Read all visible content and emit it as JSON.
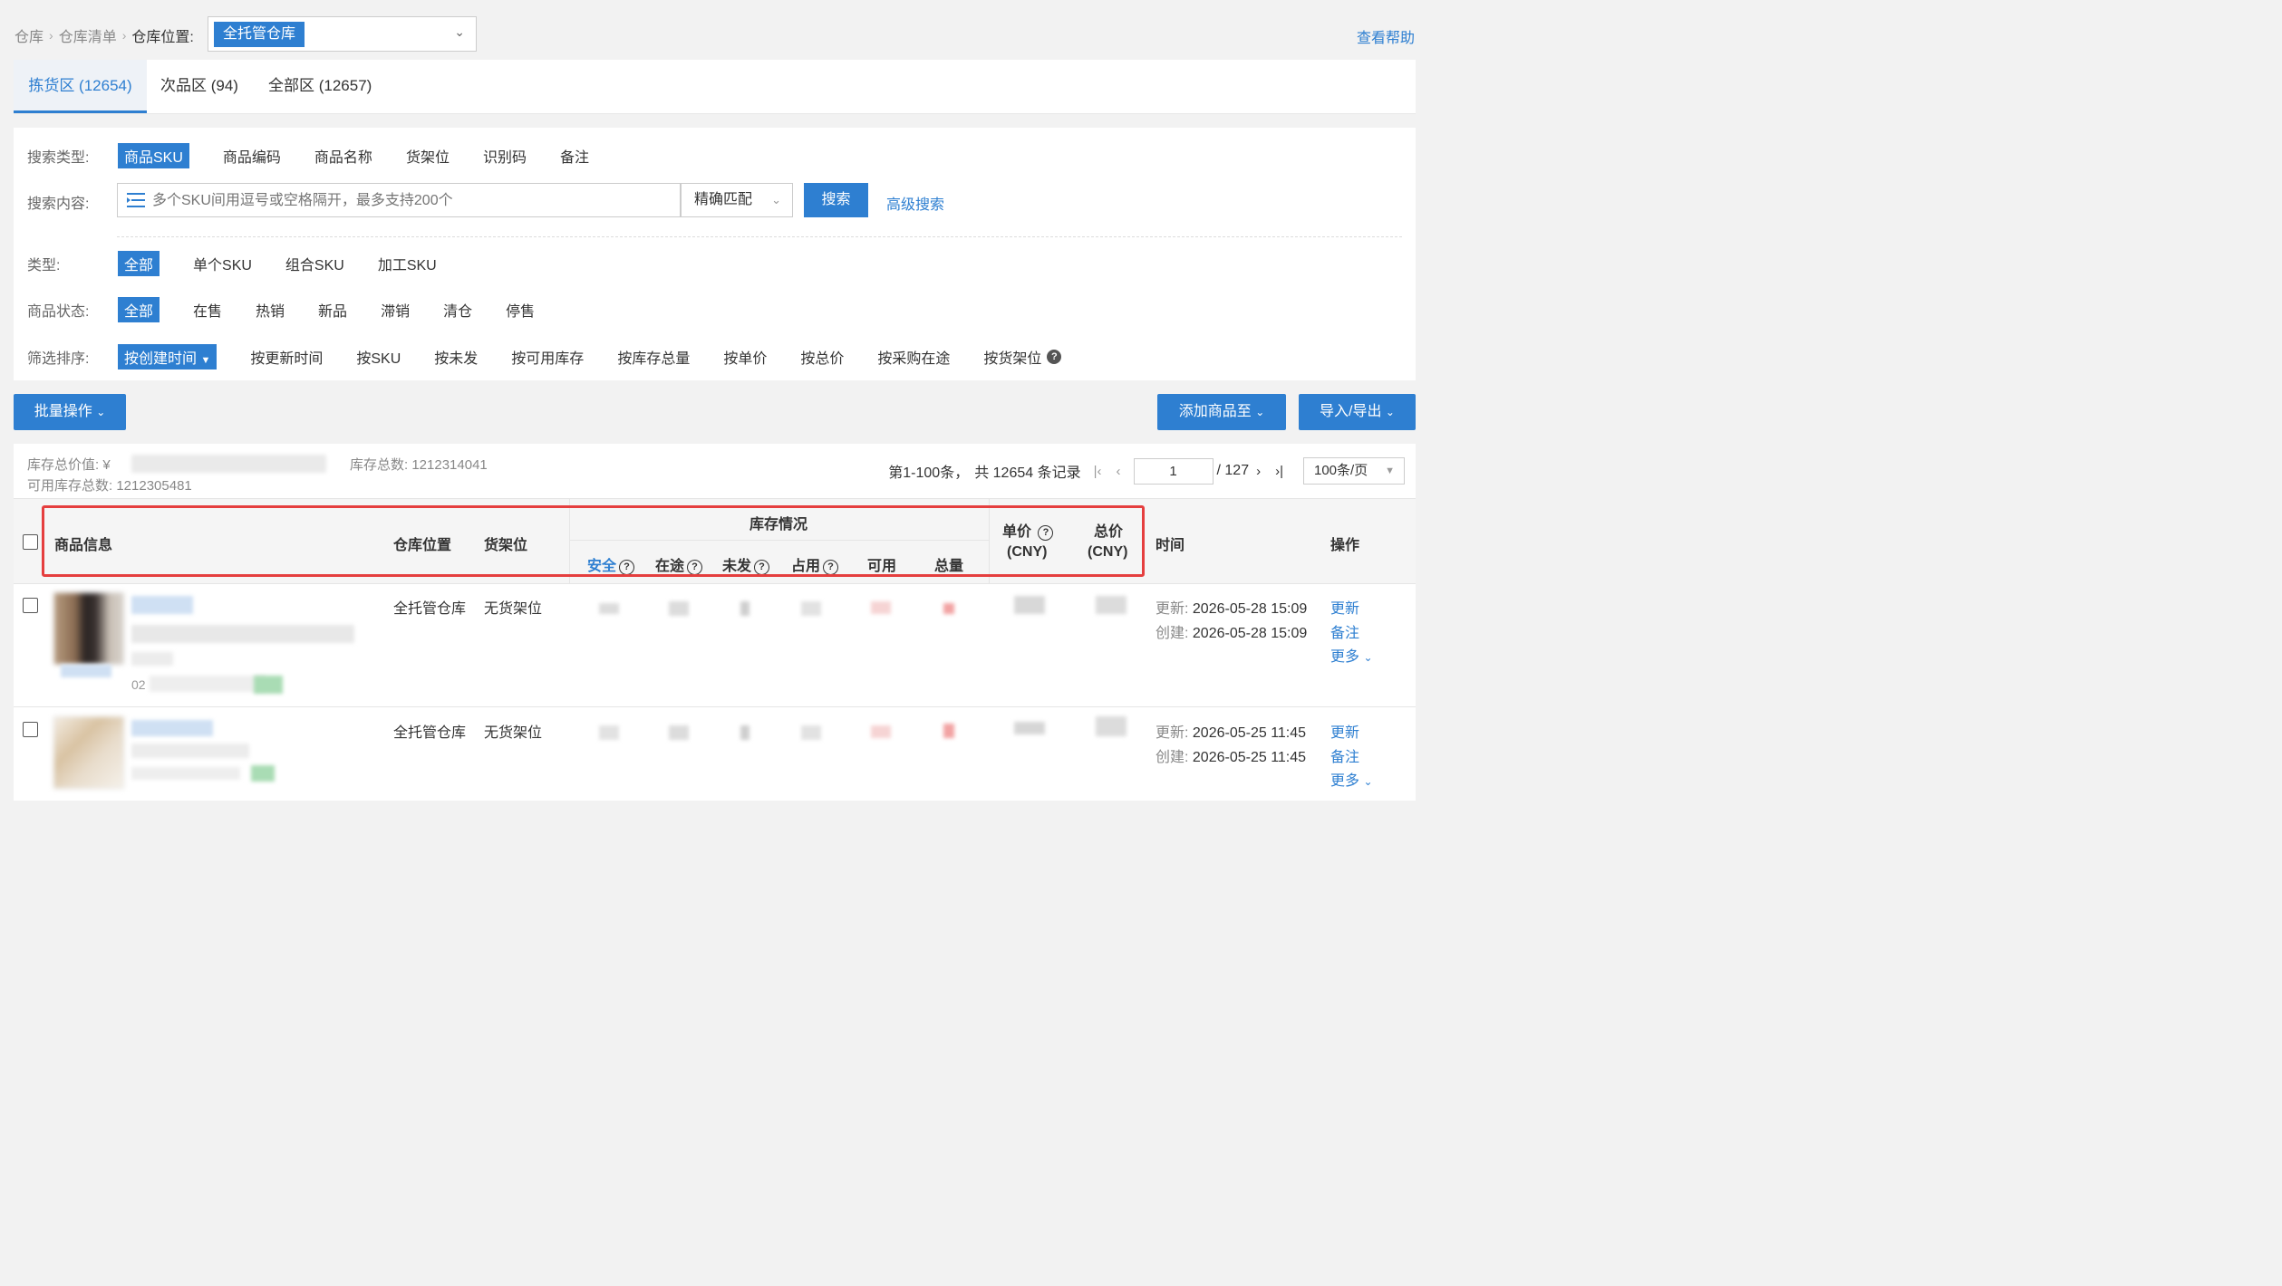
{
  "breadcrumb": {
    "items": [
      "仓库",
      "仓库清单"
    ],
    "current": "仓库位置:"
  },
  "warehouse_select": {
    "value": "全托管仓库"
  },
  "help_link": "查看帮助",
  "tabs": [
    {
      "label": "拣货区 (12654)",
      "active": true
    },
    {
      "label": "次品区 (94)",
      "active": false
    },
    {
      "label": "全部区 (12657)",
      "active": false
    }
  ],
  "filters": {
    "search_type": {
      "label": "搜索类型:",
      "options": [
        "商品SKU",
        "商品编码",
        "商品名称",
        "货架位",
        "识别码",
        "备注"
      ]
    },
    "search_content": {
      "label": "搜索内容:",
      "placeholder": "多个SKU间用逗号或空格隔开，最多支持200个",
      "match_mode": "精确匹配",
      "search_button": "搜索",
      "advanced_link": "高级搜索"
    },
    "type": {
      "label": "类型:",
      "options": [
        "全部",
        "单个SKU",
        "组合SKU",
        "加工SKU"
      ]
    },
    "status": {
      "label": "商品状态:",
      "options": [
        "全部",
        "在售",
        "热销",
        "新品",
        "滞销",
        "清仓",
        "停售"
      ]
    },
    "sort": {
      "label": "筛选排序:",
      "selected": "按创建时间",
      "options": [
        "按更新时间",
        "按SKU",
        "按未发",
        "按可用库存",
        "按库存总量",
        "按单价",
        "按总价",
        "按采购在途",
        "按货架位"
      ]
    }
  },
  "actions": {
    "batch": "批量操作",
    "add_to": "添加商品至",
    "import_export": "导入/导出"
  },
  "summary": {
    "total_value_label": "库存总价值: ¥",
    "available_label": "可用库存总数: 1212305481",
    "total_count_label": "库存总数: 1212314041"
  },
  "pager": {
    "range": "第1-100条，",
    "total": "共 12654 条记录",
    "page": "1",
    "pages": "/ 127",
    "page_size": "100条/页"
  },
  "table": {
    "headers": {
      "product": "商品信息",
      "location": "仓库位置",
      "shelf": "货架位",
      "inventory": "库存情况",
      "inv_cols": [
        "安全",
        "在途",
        "未发",
        "占用",
        "可用",
        "总量"
      ],
      "unit_price": "单价",
      "unit_price_cur": "(CNY)",
      "total_price": "总价",
      "total_price_cur": "(CNY)",
      "time": "时间",
      "ops": "操作"
    },
    "rows": [
      {
        "location": "全托管仓库",
        "shelf": "无货架位",
        "updated_label": "更新:",
        "updated": "2026-05-28 15:09",
        "created_label": "创建:",
        "created": "2026-05-28 15:09",
        "code_prefix": "02",
        "actions": [
          "更新",
          "备注",
          "更多"
        ]
      },
      {
        "location": "全托管仓库",
        "shelf": "无货架位",
        "updated_label": "更新:",
        "updated": "2026-05-25 11:45",
        "created_label": "创建:",
        "created": "2026-05-25 11:45",
        "actions": [
          "更新",
          "备注",
          "更多"
        ]
      }
    ]
  },
  "colors": {
    "accent": "#2e7fd1",
    "highlight": "#e53e3e"
  }
}
